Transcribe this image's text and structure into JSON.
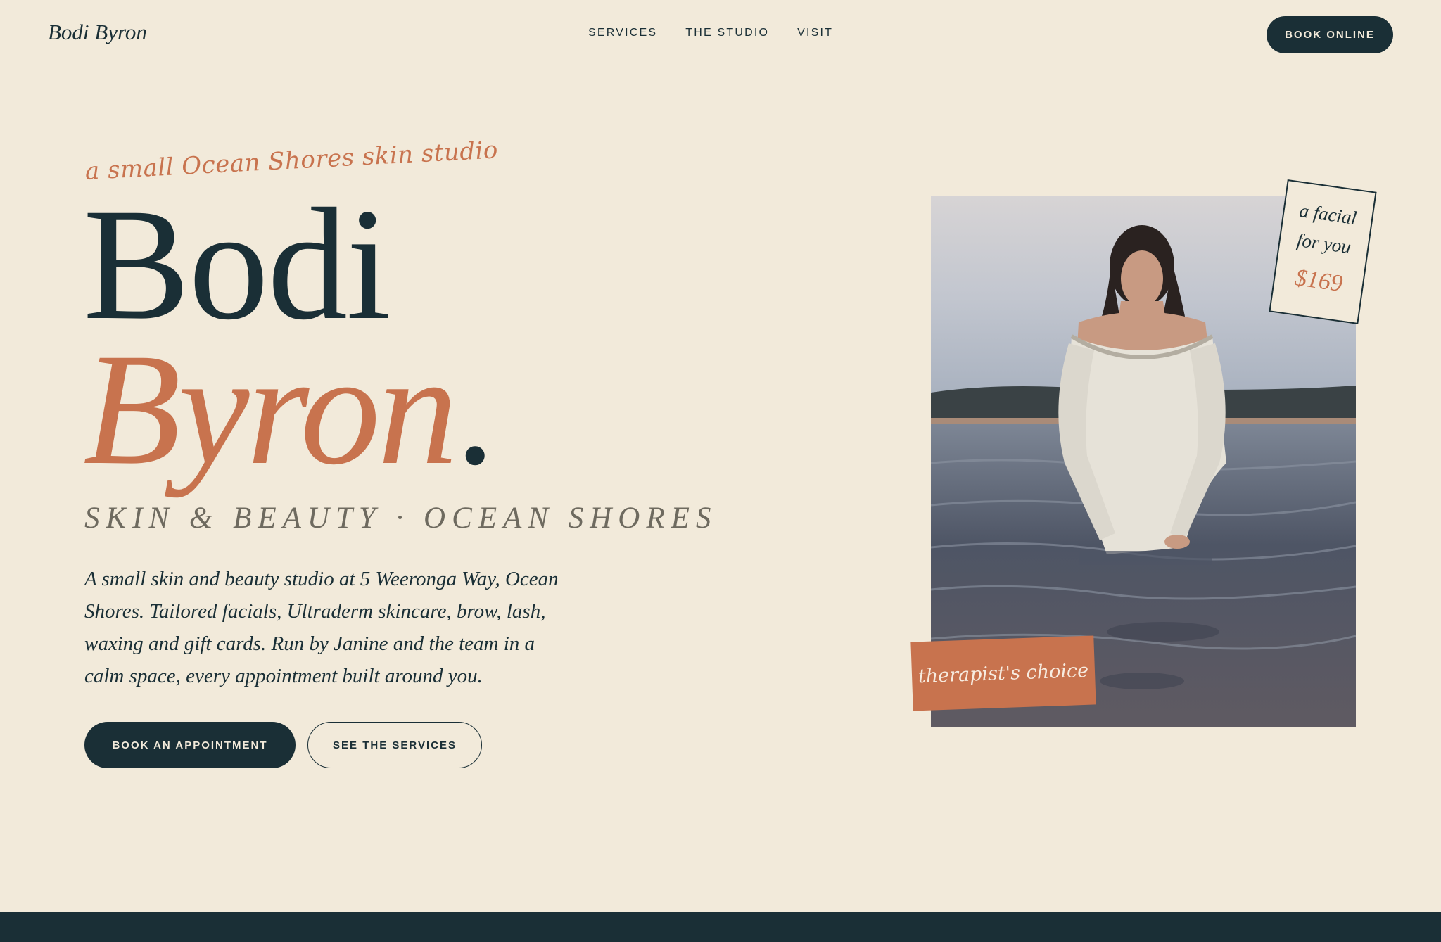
{
  "header": {
    "brand": "Bodi Byron",
    "nav": [
      "SERVICES",
      "THE STUDIO",
      "VISIT"
    ],
    "cta": "BOOK ONLINE"
  },
  "hero": {
    "tagline": "a small Ocean Shores skin studio",
    "title_line1": "Bodi",
    "title_line2": "Byron",
    "title_dot": ".",
    "subtitle": "SKIN & BEAUTY · OCEAN SHORES",
    "intro": "A small skin and beauty studio at 5 Weeronga Way, Ocean Shores. Tailored facials, Ultraderm skincare, brow, lash, waxing and gift cards. Run by Janine and the team in a calm space, every appointment built around you.",
    "primary_button": "BOOK AN APPOINTMENT",
    "secondary_button": "SEE THE SERVICES"
  },
  "feature": {
    "card_line1": "a facial",
    "card_line2": "for you",
    "price": "$169",
    "tag": "therapist's choice"
  },
  "colors": {
    "background": "#f2eada",
    "ink": "#1a2f36",
    "accent": "#c8734e"
  }
}
